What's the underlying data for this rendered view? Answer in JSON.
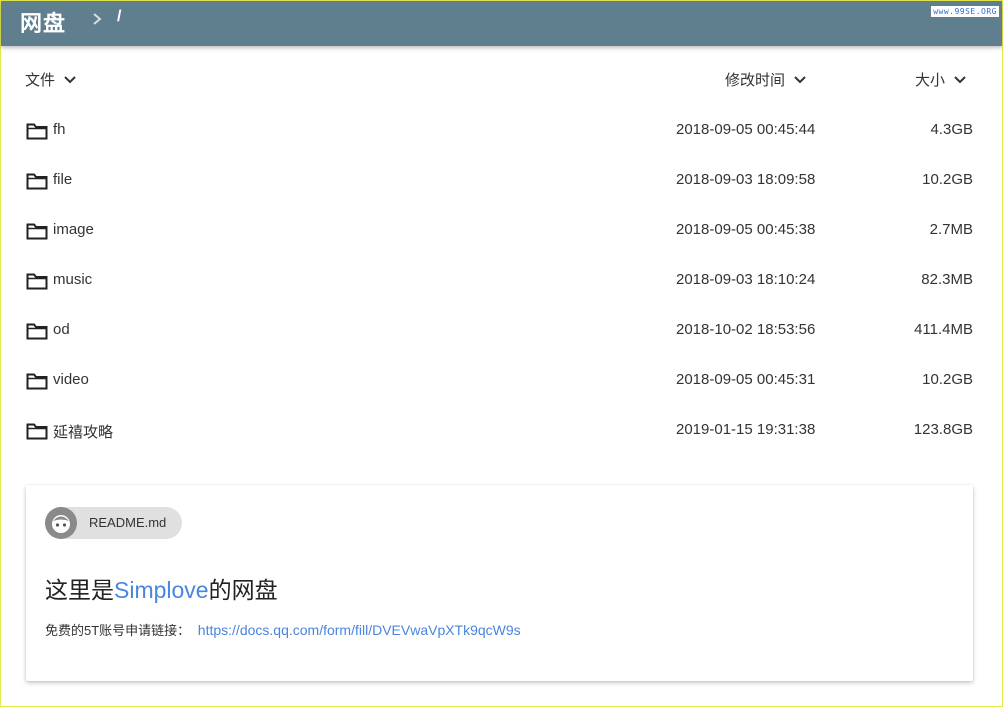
{
  "header": {
    "brand": "网盘",
    "crumb_root": "/",
    "watermark": "www.99SE.ORG",
    "bg_color": "#5f7e8e"
  },
  "columns": {
    "file": "文件",
    "modified": "修改时间",
    "size": "大小"
  },
  "files": [
    {
      "name": "fh",
      "modified": "2018-09-05 00:45:44",
      "size": "4.3GB"
    },
    {
      "name": "file",
      "modified": "2018-09-03 18:09:58",
      "size": "10.2GB"
    },
    {
      "name": "image",
      "modified": "2018-09-05 00:45:38",
      "size": "2.7MB"
    },
    {
      "name": "music",
      "modified": "2018-09-03 18:10:24",
      "size": "82.3MB"
    },
    {
      "name": "od",
      "modified": "2018-10-02 18:53:56",
      "size": "411.4MB"
    },
    {
      "name": "video",
      "modified": "2018-09-05 00:45:31",
      "size": "10.2GB"
    },
    {
      "name": "延禧攻略",
      "modified": "2019-01-15 19:31:38",
      "size": "123.8GB"
    }
  ],
  "readme": {
    "chip_label": "README.md",
    "title_prefix": "这里是",
    "title_accent": "Simplove",
    "title_suffix": "的网盘",
    "line_text": "免费的5T账号申请链接：",
    "link_text": "https://docs.qq.com/form/fill/DVEVwaVpXTk9qcW9s",
    "accent_color": "#4a85de"
  }
}
